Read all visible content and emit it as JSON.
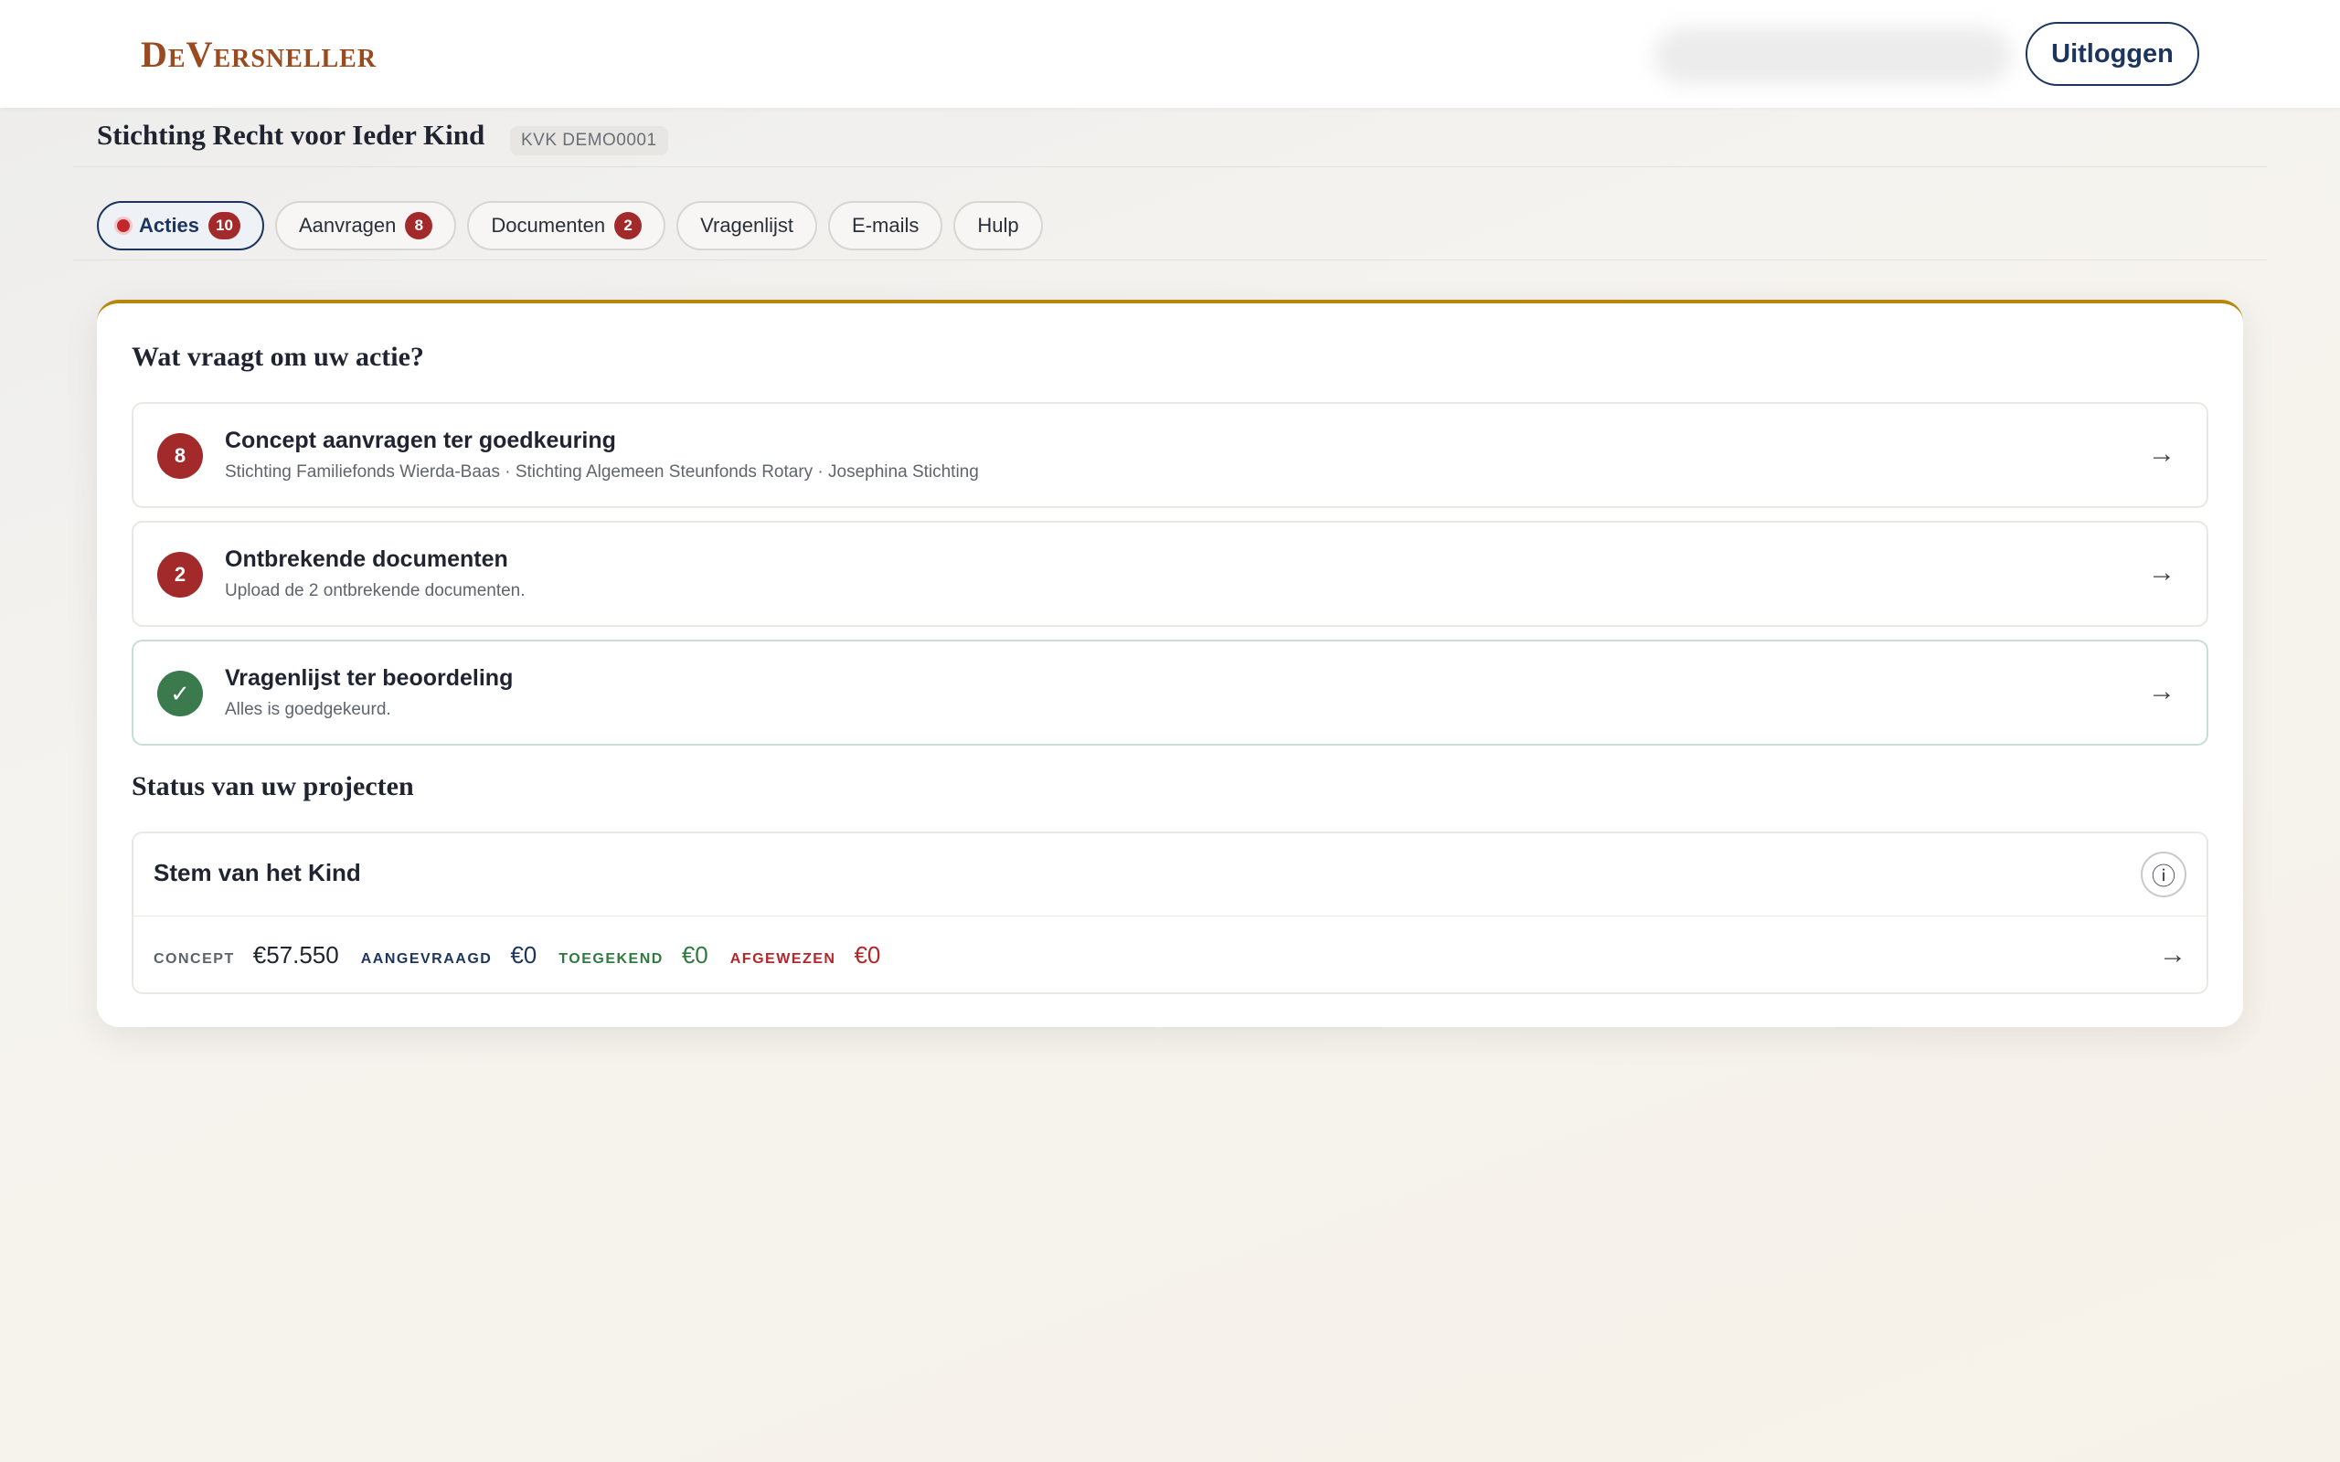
{
  "header": {
    "logo": "DeVersneller",
    "logout_label": "Uitloggen"
  },
  "org": {
    "name": "Stichting Recht voor Ieder Kind",
    "kvk": "KVK DEMO0001"
  },
  "tabs": [
    {
      "label": "Acties",
      "count": "10",
      "active": true
    },
    {
      "label": "Aanvragen",
      "count": "8"
    },
    {
      "label": "Documenten",
      "count": "2"
    },
    {
      "label": "Vragenlijst"
    },
    {
      "label": "E-mails"
    },
    {
      "label": "Hulp"
    }
  ],
  "actions": {
    "title": "Wat vraagt om uw actie?",
    "items": [
      {
        "badge": "8",
        "title": "Concept aanvragen ter goedkeuring",
        "subtitle": "Stichting Familiefonds Wierda-Baas · Stichting Algemeen Steunfonds Rotary · Josephina Stichting",
        "arrow": "→",
        "status": "alert"
      },
      {
        "badge": "2",
        "title": "Ontbrekende documenten",
        "subtitle": "Upload de 2 ontbrekende documenten.",
        "arrow": "→",
        "status": "alert"
      },
      {
        "badge": "✓",
        "title": "Vragenlijst ter beoordeling",
        "subtitle": "Alles is goedgekeurd.",
        "arrow": "→",
        "status": "ok"
      }
    ]
  },
  "projects": {
    "title": "Status van uw projecten",
    "items": [
      {
        "name": "Stem van het Kind",
        "info_icon": "ⓘ",
        "arrow": "→",
        "stats": [
          {
            "label": "Concept",
            "value": "€57.550",
            "color": "#5d6169",
            "value_color": "#1f2430"
          },
          {
            "label": "Aangevraagd",
            "value": "€0",
            "color": "#1c355e",
            "value_color": "#1c355e"
          },
          {
            "label": "Toegekend",
            "value": "€0",
            "color": "#2f7a3e",
            "value_color": "#2f7a3e"
          },
          {
            "label": "Afgewezen",
            "value": "€0",
            "color": "#b3262a",
            "value_color": "#b3262a"
          }
        ]
      }
    ]
  },
  "colors": {
    "brand": "#9a4a1f",
    "navy": "#1c355e",
    "alert": "#a32a2a",
    "success": "#3a7a4d",
    "card_accent": "#b8860b"
  }
}
